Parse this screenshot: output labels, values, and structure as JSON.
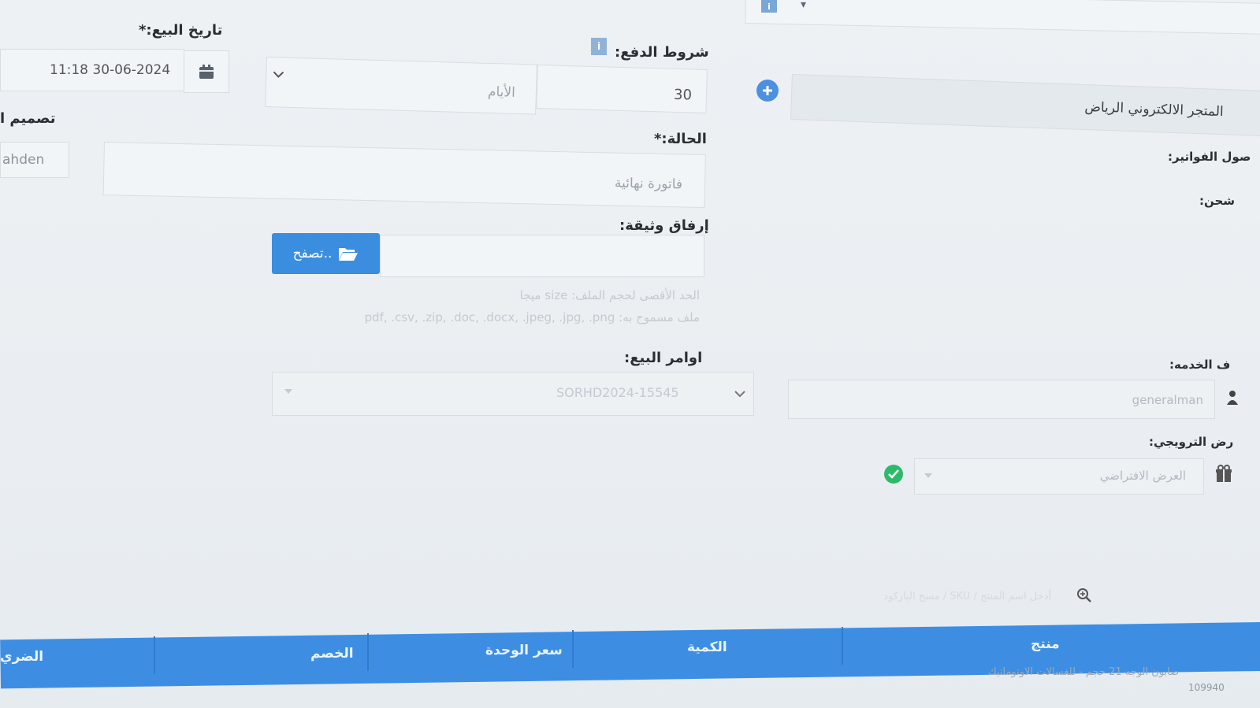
{
  "top_right": {
    "info_badge": "i",
    "dropdown_arrow": "▾"
  },
  "store_field": {
    "value": "المتجر الالكتروني الرياض"
  },
  "labels": {
    "invoices_account": "صول الفواتير:",
    "shipping": "شحن:",
    "service_staff": "ف الخدمه:",
    "promo_offer": "رض الترويجي:"
  },
  "payment_terms": {
    "label": "شروط الدفع:",
    "days_value": "30",
    "unit": "الأيام"
  },
  "sale_date": {
    "label": "تاريخ البيع:*",
    "value": "11:18 30-06-2024"
  },
  "design": {
    "label": "تصميم ا",
    "value": "ahden"
  },
  "status": {
    "label": "الحالة:*",
    "value": "فاتورة نهائية"
  },
  "attach": {
    "label": "إرفاق وثيقة:",
    "browse_label": "تصفح..",
    "hint_size": "الحد الأقصى لحجم الملف: size ميجا",
    "hint_types": "ملف مسموح به: pdf, .csv, .zip, .doc, .docx, .jpeg, .jpg, .png"
  },
  "sales_orders": {
    "label": "اوامر البيع:",
    "value": "SORHD2024-15545"
  },
  "service_staff": {
    "value": "generalman"
  },
  "promo": {
    "value": "العرض الافتراضي"
  },
  "search": {
    "placeholder": "أدخل اسم المنتج / SKU / مسح الباركود"
  },
  "table": {
    "headers": [
      "منتج",
      "الكمية",
      "سعر الوحدة",
      "الخصم",
      "الضري"
    ],
    "first_row_product": "صابون الوجه 21 حجم - للغسالات الاوتوماتيك",
    "first_row_sku": "109940"
  },
  "colors": {
    "accent": "#3b8de0",
    "header_bar": "#3d8ee3",
    "success": "#2cba6a"
  },
  "icons": [
    "info-icon",
    "plus-circle-icon",
    "calendar-icon",
    "folder-open-icon",
    "search-icon",
    "user-icon",
    "gift-icon",
    "check-circle-icon",
    "chevron-down-icon"
  ]
}
